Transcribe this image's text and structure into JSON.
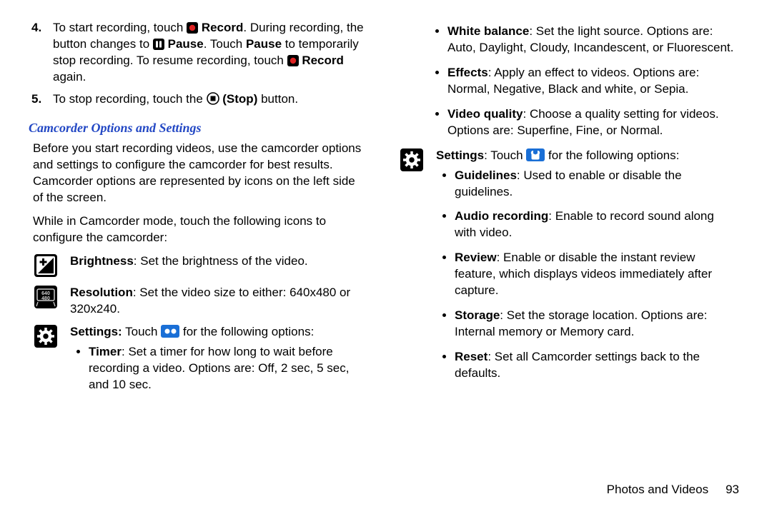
{
  "steps": {
    "s4": {
      "num": "4.",
      "pre": "To start recording, touch ",
      "rec": " Record",
      "mid1": ". During recording, the button changes to ",
      "pause": " Pause",
      "mid2": ". Touch ",
      "pauseb": "Pause",
      "mid3": " to temporarily stop recording. To resume recording, touch ",
      "rec2": " Record",
      "end": " again."
    },
    "s5": {
      "num": "5.",
      "pre": "To stop recording, touch the ",
      "stop": " (Stop)",
      "end": " button."
    }
  },
  "section_title": "Camcorder Options and Settings",
  "paras": {
    "p1": "Before you start recording videos, use the camcorder options and settings to configure the camcorder for best results. Camcorder options are represented by icons on the left side of the screen.",
    "p2": "While in Camcorder mode, touch the following icons to configure the camcorder:"
  },
  "left_items": {
    "brightness": {
      "label": "Brightness",
      "desc": ": Set the brightness of the video."
    },
    "resolution": {
      "label": "Resolution",
      "desc": ": Set the video size to either: 640x480 or 320x240."
    },
    "settings": {
      "label": "Settings:",
      "desc_pre": " Touch ",
      "desc_post": " for the following options:"
    },
    "timer": {
      "label": "Timer",
      "desc": ": Set a timer for how long to wait before recording a video. Options are: Off, 2 sec, 5 sec, and 10 sec."
    }
  },
  "right_items": {
    "wb": {
      "label": "White balance",
      "desc": ": Set the light source. Options are: Auto, Daylight, Cloudy, Incandescent, or Fluorescent."
    },
    "fx": {
      "label": "Effects",
      "desc": ": Apply an effect to videos. Options are: Normal, Negative, Black and white, or Sepia."
    },
    "vq": {
      "label": "Video quality",
      "desc": ": Choose a quality setting for videos. Options are: Superfine, Fine, or Normal."
    },
    "settings": {
      "label": "Settings",
      "desc_pre": ": Touch ",
      "desc_post": " for the following options:"
    },
    "guide": {
      "label": "Guidelines",
      "desc": ": Used to enable or disable the guidelines."
    },
    "audio": {
      "label": "Audio recording",
      "desc": ": Enable to record sound along with video."
    },
    "review": {
      "label": "Review",
      "desc": ": Enable or disable the instant review feature, which displays videos immediately after capture."
    },
    "storage": {
      "label": "Storage",
      "desc": ": Set the storage location. Options are: Internal memory or Memory card."
    },
    "reset": {
      "label": "Reset",
      "desc": ": Set all Camcorder settings back to the defaults."
    }
  },
  "footer": {
    "section": "Photos and Videos",
    "page": "93"
  }
}
